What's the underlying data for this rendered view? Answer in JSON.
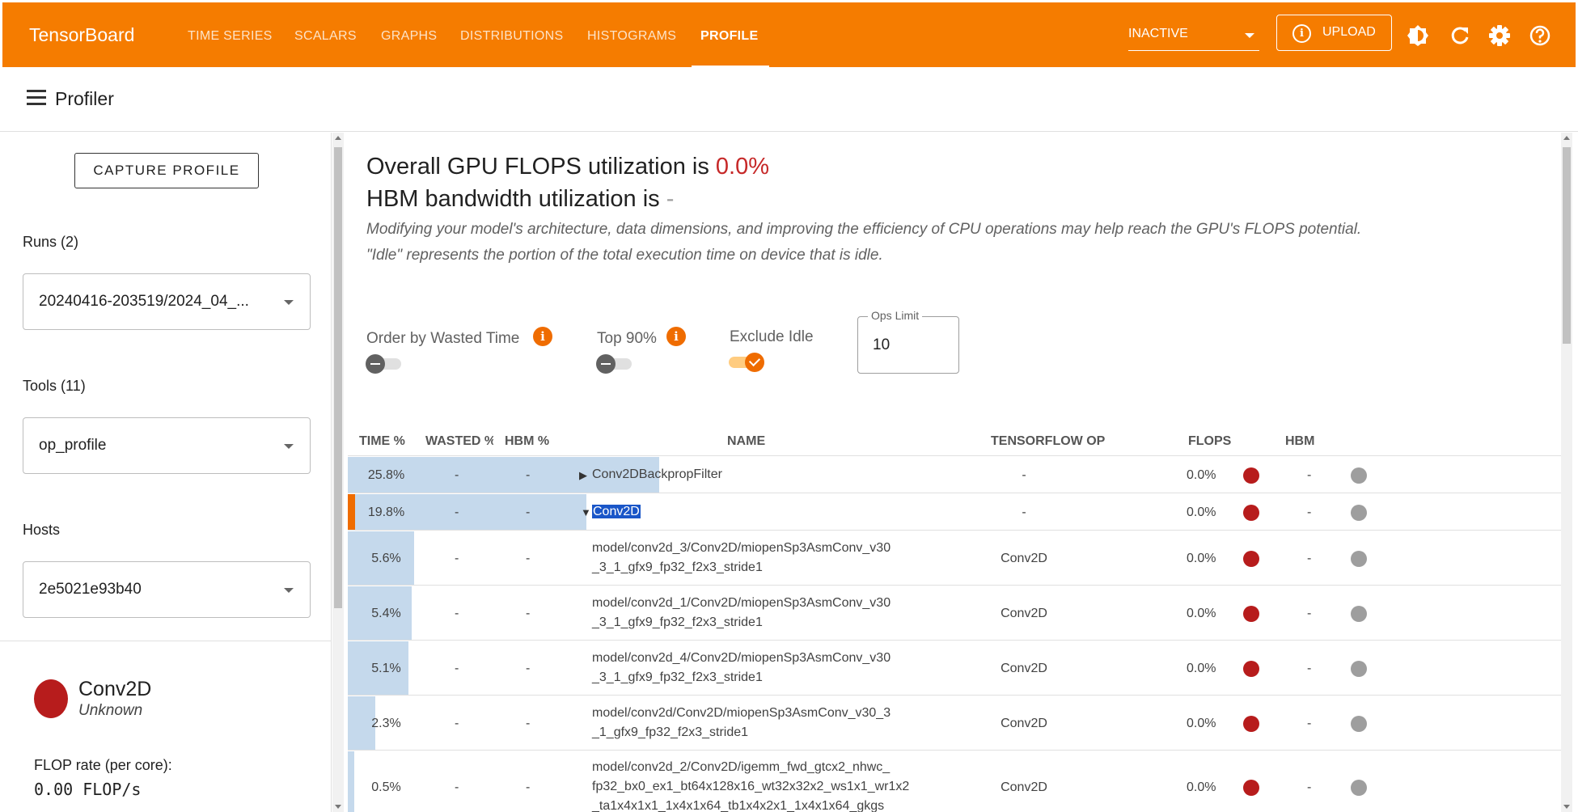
{
  "topbar": {
    "brand": "TensorBoard",
    "tabs": [
      "TIME SERIES",
      "SCALARS",
      "GRAPHS",
      "DISTRIBUTIONS",
      "HISTOGRAMS",
      "PROFILE"
    ],
    "run_select": "INACTIVE",
    "upload": "UPLOAD",
    "accent": "#f57c00"
  },
  "header": {
    "title": "Profiler"
  },
  "sidebar": {
    "capture": "CAPTURE PROFILE",
    "runs_label": "Runs (2)",
    "runs_value": "20240416-203519/2024_04_...",
    "tools_label": "Tools (11)",
    "tools_value": "op_profile",
    "hosts_label": "Hosts",
    "hosts_value": "2e5021e93b40",
    "op_name": "Conv2D",
    "op_category": "Unknown",
    "flop_label": "FLOP rate (per core):",
    "flop_value": "0.00 FLOP/s"
  },
  "summary": {
    "flops_prefix": "Overall GPU FLOPS utilization is ",
    "flops_value": "0.0%",
    "hbm_prefix": "HBM bandwidth utilization is ",
    "hbm_value": "-",
    "note1": "Modifying your model's architecture, data dimensions, and improving the efficiency of CPU operations may help reach the GPU's FLOPS potential.",
    "note2": "\"Idle\" represents the portion of the total execution time on device that is idle."
  },
  "controls": {
    "order_label": "Order by Wasted Time",
    "top_label": "Top 90%",
    "exclude_label": "Exclude Idle",
    "ops_limit_label": "Ops Limit",
    "ops_limit_value": "10",
    "order_on": false,
    "top_on": false,
    "exclude_on": true
  },
  "table": {
    "headers": [
      "TIME %",
      "WASTED %",
      "HBM %",
      "NAME",
      "TENSORFLOW OP",
      "FLOPS",
      "HBM"
    ],
    "rows": [
      {
        "time": "25.8%",
        "wasted": "-",
        "hbm_pct": "-",
        "name": "Conv2DBackpropFilter",
        "tf_op": "-",
        "flops": "0.0%",
        "hbm": "-",
        "expander": "▶",
        "bar": 0.258
      },
      {
        "time": "19.8%",
        "wasted": "-",
        "hbm_pct": "-",
        "name": "Conv2D",
        "tf_op": "-",
        "flops": "0.0%",
        "hbm": "-",
        "expander": "▼",
        "bar": 0.198
      },
      {
        "time": "5.6%",
        "wasted": "-",
        "hbm_pct": "-",
        "name": "model/conv2d_3/Conv2D/miopenSp3AsmConv_v30\n_3_1_gfx9_fp32_f2x3_stride1",
        "tf_op": "Conv2D",
        "flops": "0.0%",
        "hbm": "-",
        "bar": 0.056
      },
      {
        "time": "5.4%",
        "wasted": "-",
        "hbm_pct": "-",
        "name": "model/conv2d_1/Conv2D/miopenSp3AsmConv_v30\n_3_1_gfx9_fp32_f2x3_stride1",
        "tf_op": "Conv2D",
        "flops": "0.0%",
        "hbm": "-",
        "bar": 0.054
      },
      {
        "time": "5.1%",
        "wasted": "-",
        "hbm_pct": "-",
        "name": "model/conv2d_4/Conv2D/miopenSp3AsmConv_v30\n_3_1_gfx9_fp32_f2x3_stride1",
        "tf_op": "Conv2D",
        "flops": "0.0%",
        "hbm": "-",
        "bar": 0.051
      },
      {
        "time": "2.3%",
        "wasted": "-",
        "hbm_pct": "-",
        "name": "model/conv2d/Conv2D/miopenSp3AsmConv_v30_3\n_1_gfx9_fp32_f2x3_stride1",
        "tf_op": "Conv2D",
        "flops": "0.0%",
        "hbm": "-",
        "bar": 0.023
      },
      {
        "time": "0.5%",
        "wasted": "-",
        "hbm_pct": "-",
        "name": "model/conv2d_2/Conv2D/igemm_fwd_gtcx2_nhwc_\nfp32_bx0_ex1_bt64x128x16_wt32x32x2_ws1x1_wr1x2\n_ta1x4x1x1_1x4x1x64_tb1x4x2x1_1x4x1x64_gkgs",
        "tf_op": "Conv2D",
        "flops": "0.0%",
        "hbm": "-",
        "bar": 0.005
      }
    ]
  }
}
